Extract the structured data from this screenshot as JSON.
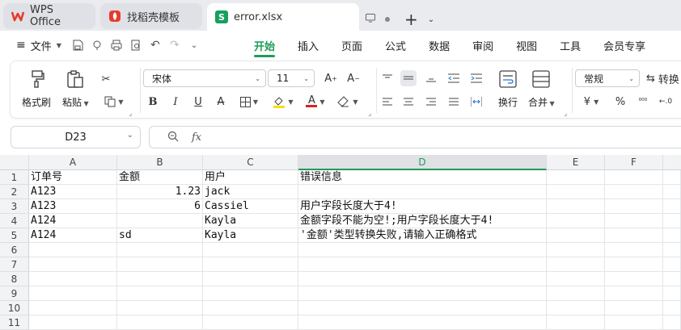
{
  "tabs": [
    {
      "label": "WPS Office",
      "icon": "wps-logo-icon"
    },
    {
      "label": "找稻壳模板",
      "icon": "docer-logo-icon"
    },
    {
      "label": "error.xlsx",
      "icon": "spreadsheet-logo-icon",
      "logo_letter": "S"
    }
  ],
  "menu": {
    "file_label": "文件",
    "tabs": [
      "开始",
      "插入",
      "页面",
      "公式",
      "数据",
      "审阅",
      "视图",
      "工具",
      "会员专享"
    ],
    "active_tab": "开始"
  },
  "ribbon": {
    "format_painter": "格式刷",
    "paste": "粘贴",
    "font_name": "宋体",
    "font_size": "11",
    "wrap": "换行",
    "merge": "合并",
    "number_format": "常规",
    "convert": "转换",
    "currency_symbol": "¥",
    "percent_symbol": "%"
  },
  "formula_bar": {
    "cell_ref": "D23",
    "fx_label": "fx",
    "value": ""
  },
  "grid": {
    "columns": [
      "A",
      "B",
      "C",
      "D",
      "E",
      "F"
    ],
    "selected_column": "D",
    "row_numbers": [
      "1",
      "2",
      "3",
      "4",
      "5",
      "6",
      "7",
      "8",
      "9",
      "10",
      "11"
    ],
    "rows": [
      [
        "订单号",
        "金额",
        "用户",
        "错误信息"
      ],
      [
        "A123",
        "1.23",
        "jack",
        ""
      ],
      [
        "A123",
        "6",
        "Cassiel",
        "用户字段长度大于4!"
      ],
      [
        "A124",
        "",
        "Kayla",
        "金额字段不能为空!;用户字段长度大于4!"
      ],
      [
        "A124",
        "sd",
        "Kayla",
        "'金额'类型转换失败,请输入正确格式"
      ]
    ]
  },
  "colors": {
    "accent": "#1f9d55",
    "wps_red": "#e63b2e",
    "excel_green": "#17a05d"
  }
}
